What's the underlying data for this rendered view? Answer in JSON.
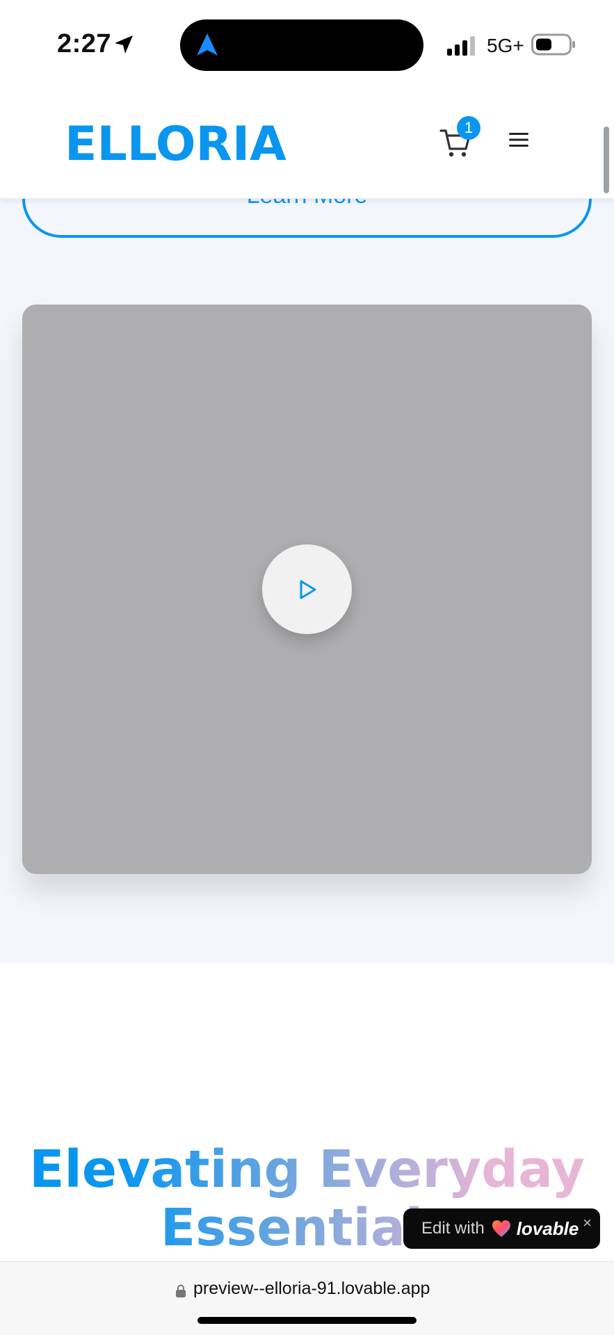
{
  "status_bar": {
    "time": "2:27",
    "network": "5G+"
  },
  "header": {
    "brand": "ELLORIA",
    "cart_count": "1"
  },
  "hero": {
    "learn_more_label": "Learn More"
  },
  "section": {
    "headline_line1": "Elevating Everyday",
    "headline_line2": "Essentials"
  },
  "lovable_badge": {
    "edit_text": "Edit with",
    "brand_text": "lovable",
    "close_glyph": "×"
  },
  "browser": {
    "url": "preview--elloria-91.lovable.app"
  },
  "colors": {
    "accent": "#0a96ef",
    "video_bg": "#aeaeb0"
  }
}
